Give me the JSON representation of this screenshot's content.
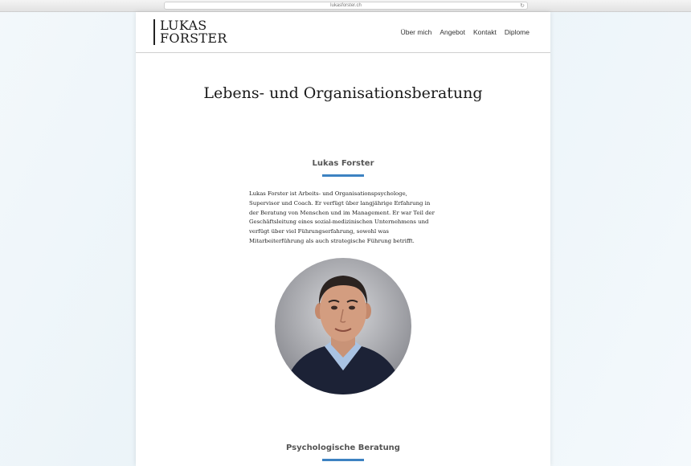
{
  "browser": {
    "url": "lukasforster.ch"
  },
  "header": {
    "logo_line1": "LUKAS",
    "logo_line2": "FORSTER",
    "nav": [
      {
        "label": "Über mich"
      },
      {
        "label": "Angebot"
      },
      {
        "label": "Kontakt"
      },
      {
        "label": "Diplome"
      }
    ]
  },
  "main": {
    "title": "Lebens- und Organisationsberatung",
    "about": {
      "heading": "Lukas Forster",
      "text": "Lukas Forster ist Arbeits- und Organisationspsychologe, Supervisor und Coach. Er verfügt über langjährige Erfahrung in der Beratung von Menschen und im Management. Er war Teil der Geschäftsleitung eines sozial-medizinischen Unternehmens und verfügt über viel Führungserfahrung, sowohl was Mitarbeiterführung als auch strategische Führung betrifft."
    },
    "next_section": {
      "heading": "Psychologische Beratung"
    }
  },
  "colors": {
    "accent": "#3d82c2",
    "heading": "#555555",
    "text": "#222222"
  }
}
